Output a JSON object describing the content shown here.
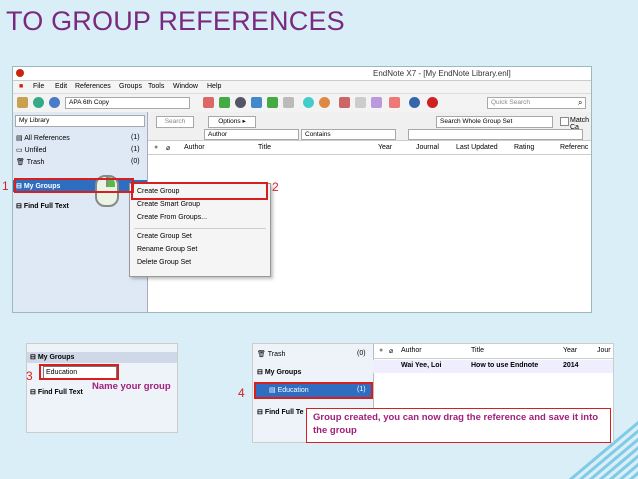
{
  "slide": {
    "title": "TO GROUP REFERENCES"
  },
  "window": {
    "title": "EndNote X7 - [My EndNote Library.enl]"
  },
  "menu": [
    "File",
    "Edit",
    "References",
    "Groups",
    "Tools",
    "Window",
    "Help"
  ],
  "toolbar": {
    "style": "APA 6th Copy",
    "quick_search_placeholder": "Quick Search"
  },
  "search": {
    "button": "Search",
    "options": "Options ▸",
    "scope": "Search Whole Group Set",
    "match_case": "Match Ca",
    "field": "Author",
    "operator": "Contains"
  },
  "sidebar": {
    "library": "My Library",
    "items": [
      {
        "label": "All References",
        "count": "(1)"
      },
      {
        "label": "Unfiled",
        "count": "(1)"
      },
      {
        "label": "Trash",
        "count": "(0)"
      }
    ],
    "my_groups": "My Groups",
    "find_full_text": "Find Full Text"
  },
  "columns": [
    "Author",
    "Title",
    "Year",
    "Journal",
    "Last Updated",
    "Rating",
    "Referenc"
  ],
  "context_menu": {
    "group1": [
      "Create Group",
      "Create Smart Group",
      "Create From Groups..."
    ],
    "group2": [
      "Create Group Set",
      "Rename Group Set",
      "Delete Group Set"
    ]
  },
  "steps": {
    "s1": "1",
    "s2": "2",
    "s3": "3",
    "s4": "4"
  },
  "shot2": {
    "my_groups": "My Groups",
    "input_value": "Education",
    "find_full_text": "Find Full Text"
  },
  "annotations": {
    "name_group": "Name your group",
    "created": "Group created, you can now drag the reference and save it into the group"
  },
  "shot3": {
    "trash": "Trash",
    "trash_count": "(0)",
    "my_groups": "My Groups",
    "group": "Education",
    "group_count": "(1)",
    "find_full_text": "Find Full Te",
    "columns": [
      "Author",
      "Title",
      "Year",
      "Jour"
    ],
    "row": {
      "author": "Wai Yee, Loi",
      "title": "How to use Endnote",
      "year": "2014"
    }
  }
}
